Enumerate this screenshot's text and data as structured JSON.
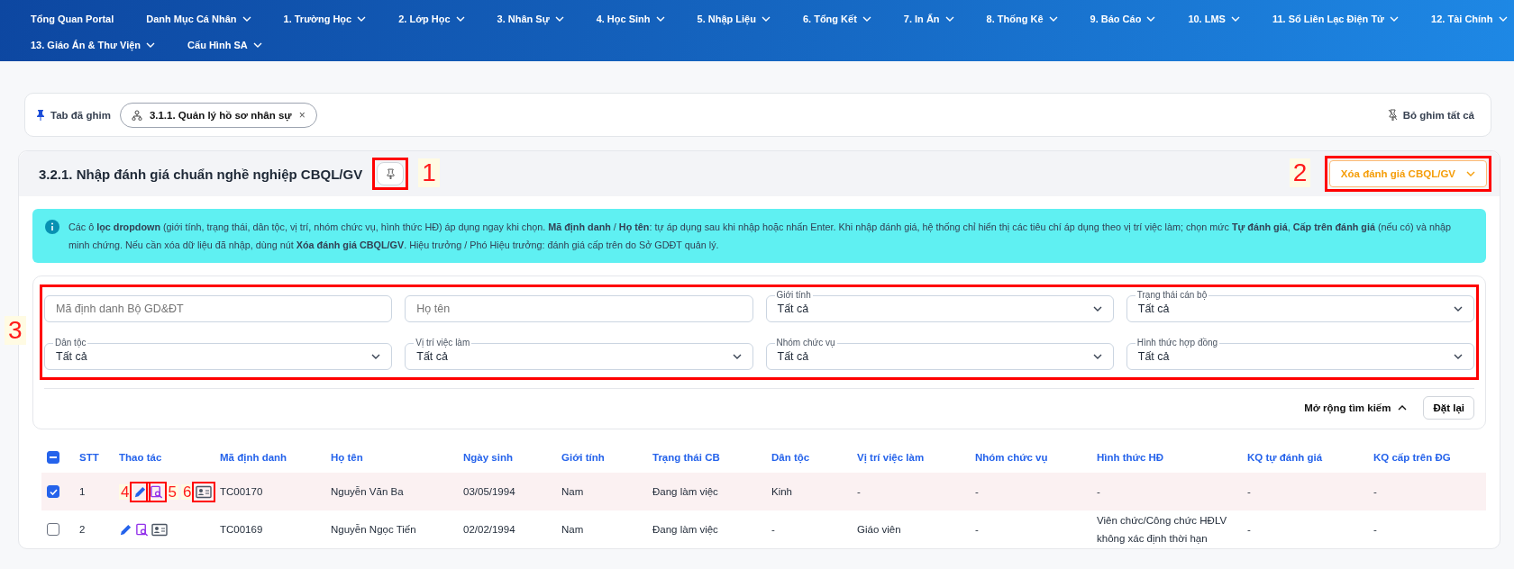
{
  "nav": {
    "rows": [
      [
        {
          "label": "Tổng Quan Portal",
          "has_menu": false
        },
        {
          "label": "Danh Mục Cá Nhân",
          "has_menu": true
        },
        {
          "label": "1. Trường Học",
          "has_menu": true
        },
        {
          "label": "2. Lớp Học",
          "has_menu": true
        },
        {
          "label": "3. Nhân Sự",
          "has_menu": true
        },
        {
          "label": "4. Học Sinh",
          "has_menu": true
        },
        {
          "label": "5. Nhập Liệu",
          "has_menu": true
        },
        {
          "label": "6. Tổng Kết",
          "has_menu": true
        },
        {
          "label": "7. In Ấn",
          "has_menu": true
        },
        {
          "label": "8. Thống Kê",
          "has_menu": true
        },
        {
          "label": "9. Báo Cáo",
          "has_menu": true
        },
        {
          "label": "10. LMS",
          "has_menu": true
        },
        {
          "label": "11. Sổ Liên Lạc Điện Tử",
          "has_menu": true
        },
        {
          "label": "12. Tài Chính",
          "has_menu": true
        }
      ],
      [
        {
          "label": "13. Giáo Án & Thư Viện",
          "has_menu": true
        },
        {
          "label": "Cấu Hình SA",
          "has_menu": true
        }
      ]
    ]
  },
  "pinned_bar": {
    "label": "Tab đã ghim",
    "tabs": [
      {
        "label": "3.1.1. Quản lý hồ sơ nhân sự",
        "close": "×"
      }
    ],
    "unpin_all": "Bỏ ghim tất cả"
  },
  "page": {
    "title": "3.2.1. Nhập đánh giá chuẩn nghề nghiệp CBQL/GV",
    "pin_button": {
      "annotation": "1"
    },
    "clear_button": {
      "label": "Xóa đánh giá CBQL/GV",
      "annotation": "2"
    }
  },
  "info": "Các ô **lọc dropdown** (giới tính, trạng thái, dân tộc, vị trí, nhóm chức vụ, hình thức HĐ) áp dụng ngay khi chọn. **Mã định danh** / **Họ tên**: tự áp dụng sau khi nhập hoặc nhấn Enter. Khi nhập đánh giá, hệ thống chỉ hiển thị các tiêu chí áp dụng theo vị trí việc làm; chọn mức **Tự đánh giá**, **Cấp trên đánh giá** (nếu có) và nhập minh chứng. Nếu cần xóa dữ liệu đã nhập, dùng nút **Xóa đánh giá CBQL/GV**. Hiệu trưởng / Phó Hiệu trưởng: đánh giá cấp trên do Sở GDĐT quản lý.",
  "filters": {
    "annotation": "3",
    "fields": [
      {
        "kind": "text",
        "placeholder": "Mã định danh Bộ GD&ĐT"
      },
      {
        "kind": "text",
        "placeholder": "Họ tên"
      },
      {
        "kind": "select",
        "label": "Giới tính",
        "value": "Tất cả"
      },
      {
        "kind": "select",
        "label": "Trạng thái cán bộ",
        "value": "Tất cả"
      },
      {
        "kind": "select",
        "label": "Dân tộc",
        "value": "Tất cả"
      },
      {
        "kind": "select",
        "label": "Vị trí việc làm",
        "value": "Tất cả"
      },
      {
        "kind": "select",
        "label": "Nhóm chức vụ",
        "value": "Tất cả"
      },
      {
        "kind": "select",
        "label": "Hình thức hợp đồng",
        "value": "Tất cả"
      }
    ],
    "expand": {
      "label": "Mở rộng tìm kiếm",
      "expanded": true
    },
    "reset": "Đặt lại"
  },
  "table": {
    "select_all": {
      "indeterminate": true
    },
    "columns": [
      "STT",
      "Thao tác",
      "Mã định danh",
      "Họ tên",
      "Ngày sinh",
      "Giới tính",
      "Trạng thái CB",
      "Dân tộc",
      "Vị trí việc làm",
      "Nhóm chức vụ",
      "Hình thức HĐ",
      "KQ tự đánh giá",
      "KQ cấp trên ĐG"
    ],
    "rows": [
      {
        "checked": true,
        "selected": true,
        "actions": [
          {
            "kind": "edit",
            "annotation": "4"
          },
          {
            "kind": "review",
            "annotation": "5"
          },
          {
            "kind": "profile",
            "annotation": "6"
          }
        ],
        "cells": [
          "1",
          "",
          "TC00170",
          "Nguyễn Văn Ba",
          "03/05/1994",
          "Nam",
          "Đang làm việc",
          "Kinh",
          "-",
          "-",
          "-",
          "-",
          "-"
        ]
      },
      {
        "checked": false,
        "selected": false,
        "actions": [
          {
            "kind": "edit"
          },
          {
            "kind": "review"
          },
          {
            "kind": "profile"
          }
        ],
        "cells": [
          "2",
          "",
          "TC00169",
          "Nguyễn Ngọc Tiến",
          "02/02/1994",
          "Nam",
          "Đang làm việc",
          "-",
          "Giáo viên",
          "-",
          "Viên chức/Công chức HĐLV không xác định thời hạn",
          "-",
          "-"
        ]
      }
    ]
  }
}
